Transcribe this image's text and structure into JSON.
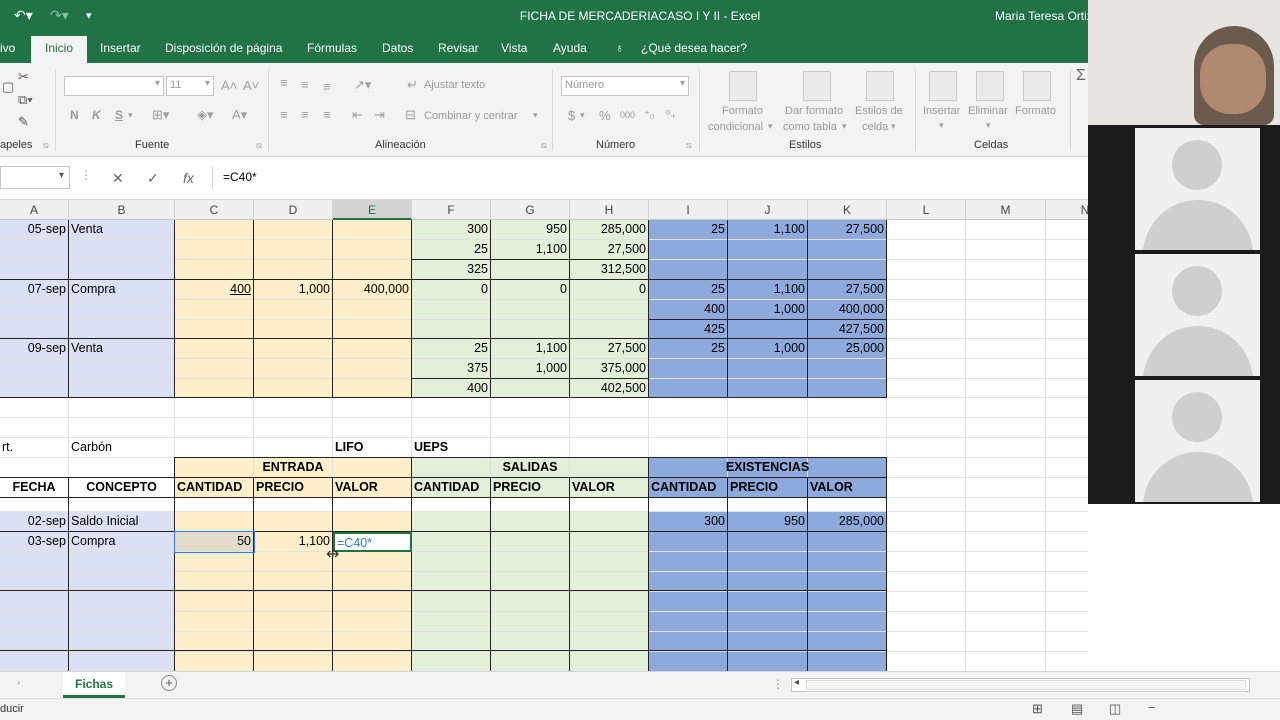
{
  "window": {
    "title": "FICHA DE MERCADERIACASO I Y II  -  Excel",
    "user": "Maria Teresa Ortiz"
  },
  "menu": {
    "tabs": [
      "ivo",
      "Inicio",
      "Insertar",
      "Disposición de página",
      "Fórmulas",
      "Datos",
      "Revisar",
      "Vista",
      "Ayuda"
    ],
    "tell_me": "¿Qué desea hacer?"
  },
  "ribbon": {
    "groups": [
      "apeles",
      "Fuente",
      "Alineación",
      "Número",
      "Estilos",
      "Celdas"
    ],
    "font_size": "11",
    "font_buttons": [
      "N",
      "K",
      "S"
    ],
    "wrap_text": "Ajustar texto",
    "merge_center": "Combinar y centrar",
    "number_format": "Número",
    "percent": "%",
    "thousands": "000",
    "currency": "$",
    "conditional_format": [
      "Formato",
      "condicional"
    ],
    "format_table": [
      "Dar formato",
      "como tabla"
    ],
    "cell_styles": [
      "Estilos de",
      "celda"
    ],
    "insert": "Insertar",
    "delete": "Eliminar",
    "format": "Formato"
  },
  "formula_bar": {
    "formula": "=C40*"
  },
  "columns": [
    "A",
    "B",
    "C",
    "D",
    "E",
    "F",
    "G",
    "H",
    "I",
    "J",
    "K",
    "L",
    "M",
    "N"
  ],
  "sheet": {
    "upper_rows": [
      {
        "date": "05-sep",
        "concept": "Venta",
        "F": [
          "300",
          "25",
          "325"
        ],
        "G": [
          "950",
          "1,100",
          ""
        ],
        "H": [
          "285,000",
          "27,500",
          "312,500"
        ],
        "I": [
          "25"
        ],
        "J": [
          "1,100"
        ],
        "K": [
          "27,500"
        ]
      },
      {
        "date": "07-sep",
        "concept": "Compra",
        "C": "400",
        "D": "1,000",
        "E": "400,000",
        "F": [
          "0"
        ],
        "G": [
          "0"
        ],
        "H": [
          "0"
        ],
        "I": [
          "25",
          "400",
          "425"
        ],
        "J": [
          "1,100",
          "1,000",
          ""
        ],
        "K": [
          "27,500",
          "400,000",
          "427,500"
        ]
      },
      {
        "date": "09-sep",
        "concept": "Venta",
        "F": [
          "25",
          "375",
          "400"
        ],
        "G": [
          "1,100",
          "1,000",
          ""
        ],
        "H": [
          "27,500",
          "375,000",
          "402,500"
        ],
        "I": [
          "25"
        ],
        "J": [
          "1,000"
        ],
        "K": [
          "25,000"
        ]
      }
    ],
    "article_label": "rt.",
    "article_value": "Carbón",
    "method_1": "LIFO",
    "method_2": "UEPS",
    "section_headers": [
      "ENTRADA",
      "SALIDAS",
      "EXISTENCIAS"
    ],
    "col_headers": [
      "FECHA",
      "CONCEPTO",
      "CANTIDAD",
      "PRECIO",
      "VALOR",
      "CANTIDAD",
      "PRECIO",
      "VALOR",
      "CANTIDAD",
      "PRECIO",
      "VALOR"
    ],
    "lower_rows": [
      {
        "date": "02-sep",
        "concept": "Saldo Inicial",
        "I": "300",
        "J": "950",
        "K": "285,000"
      },
      {
        "date": "03-sep",
        "concept": "Compra",
        "C": "50",
        "D": "1,100",
        "E": "=C40*"
      }
    ]
  },
  "sheet_tab": "Fichas",
  "status": "ducir",
  "colors": {
    "excel_green": "#217346",
    "entrada_fill": "#fcefc9",
    "salidas_fill": "#e2efd9",
    "existencias_fill": "#8ea9db",
    "concept_fill": "#dbe0f4"
  }
}
